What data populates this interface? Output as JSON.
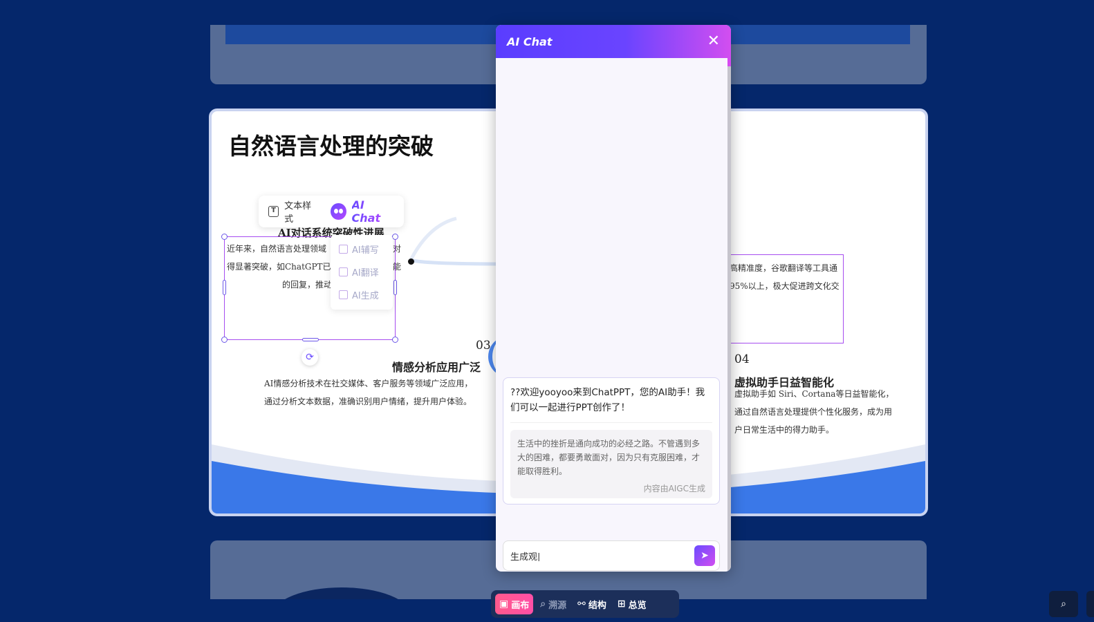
{
  "slide": {
    "title": "自然语言处理的突破",
    "section1": {
      "heading": "AI对话系统突破性进展",
      "line1": "近年来，自然语言处理领域",
      "line1b": "对",
      "line2": "得显著突破，如ChatGPT已",
      "line2b": "能",
      "line3": "的回复，推动"
    },
    "section2": {
      "line1": "高精准度，谷歌翻译等工具通",
      "line2": "95%以上，极大促进跨文化交"
    },
    "section3": {
      "number": "03",
      "heading": "情感分析应用广泛",
      "line1": "AI情感分析技术在社交媒体、客户服务等领域广泛应用，",
      "line2": "通过分析文本数据，准确识别用户情绪，提升用户体验。"
    },
    "section4": {
      "number": "04",
      "heading": "虚拟助手日益智能化",
      "line1": "虚拟助手如 Siri、Cortana等日益智能化，",
      "line2": "通过自然语言处理提供个性化服务，成为用",
      "line3": "户日常生活中的得力助手。"
    }
  },
  "text_toolbar": {
    "text_style_label": "文本样式",
    "ai_chat_label": "AI Chat"
  },
  "ai_menu": {
    "items": [
      {
        "label": "AI辅写",
        "icon": "ai-write-icon"
      },
      {
        "label": "AI翻译",
        "icon": "ai-translate-icon"
      },
      {
        "label": "AI生成",
        "icon": "ai-generate-icon"
      }
    ]
  },
  "chat": {
    "title": "AI Chat",
    "welcome": "??欢迎yooyoo来到ChatPPT，您的AI助手！我们可以一起进行PPT创作了！",
    "quote": "生活中的挫折是通向成功的必经之路。不管遇到多大的困难，都要勇敢面对，因为只有克服困难，才能取得胜利。",
    "quote_source": "内容由AIGC生成",
    "input_value": "生成观|",
    "input_placeholder": ""
  },
  "bottom_bar": {
    "canvas": "画布",
    "trace": "溯源",
    "structure": "结构",
    "overview": "总览"
  },
  "colors": {
    "background": "#05276b",
    "accent_purple": "#6a44ff",
    "accent_pink": "#d24ef0",
    "active_tab": "#ff5a8c"
  }
}
